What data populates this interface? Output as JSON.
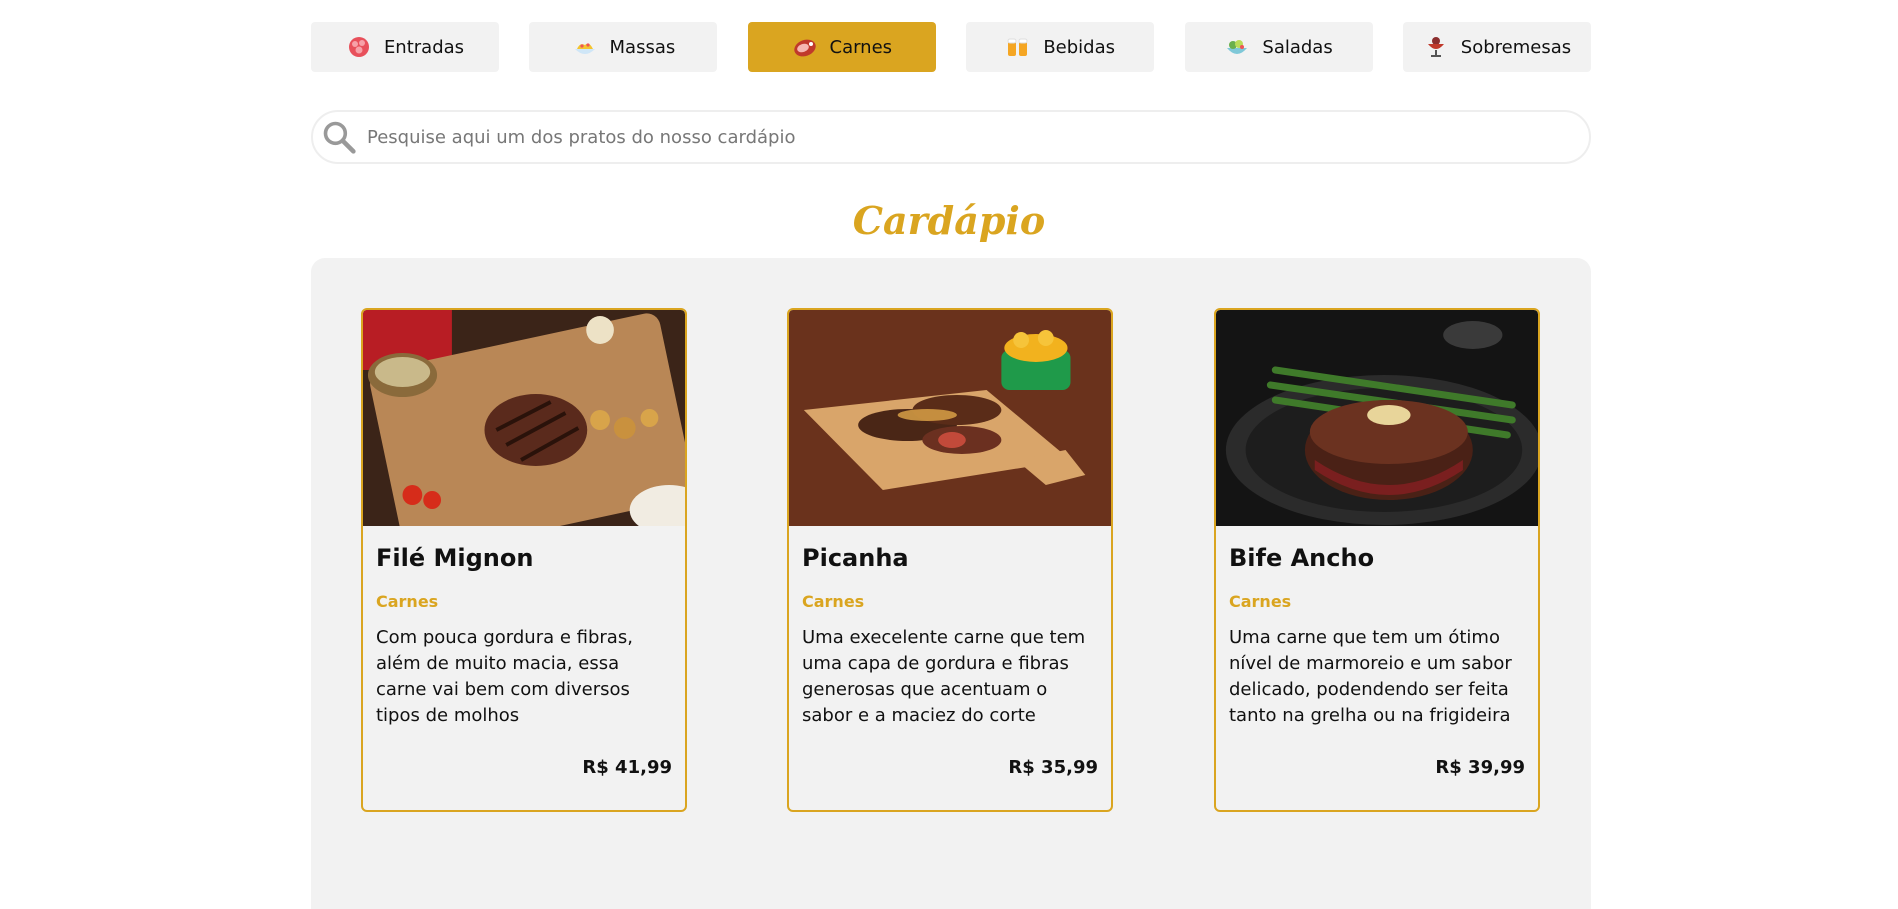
{
  "tabs": [
    {
      "label": "Entradas",
      "icon": "appetizer-icon",
      "active": false
    },
    {
      "label": "Massas",
      "icon": "pasta-icon",
      "active": false
    },
    {
      "label": "Carnes",
      "icon": "meat-icon",
      "active": true
    },
    {
      "label": "Bebidas",
      "icon": "drinks-icon",
      "active": false
    },
    {
      "label": "Saladas",
      "icon": "salad-icon",
      "active": false
    },
    {
      "label": "Sobremesas",
      "icon": "dessert-icon",
      "active": false
    }
  ],
  "search": {
    "placeholder": "Pesquise aqui um dos pratos do nosso cardápio",
    "value": ""
  },
  "menu": {
    "title": "Cardápio",
    "items": [
      {
        "name": "Filé Mignon",
        "category": "Carnes",
        "description": "Com pouca gordura e fibras, além de muito macia, essa carne vai bem com diversos tipos de molhos",
        "price": "R$ 41,99",
        "image": "file-mignon-photo"
      },
      {
        "name": "Picanha",
        "category": "Carnes",
        "description": "Uma execelente carne que tem uma capa de gordura e fibras generosas que acentuam o sabor e a maciez do corte",
        "price": "R$ 35,99",
        "image": "picanha-photo"
      },
      {
        "name": "Bife Ancho",
        "category": "Carnes",
        "description": "Uma carne que tem um ótimo nível de marmoreio e um sabor delicado, podendendo ser feita tanto na grelha ou na frigideira",
        "price": "R$ 39,99",
        "image": "bife-ancho-photo"
      }
    ]
  },
  "colors": {
    "accent": "#DAA520",
    "tab_bg": "#f2f2f2",
    "panel_bg": "#f2f2f2"
  }
}
